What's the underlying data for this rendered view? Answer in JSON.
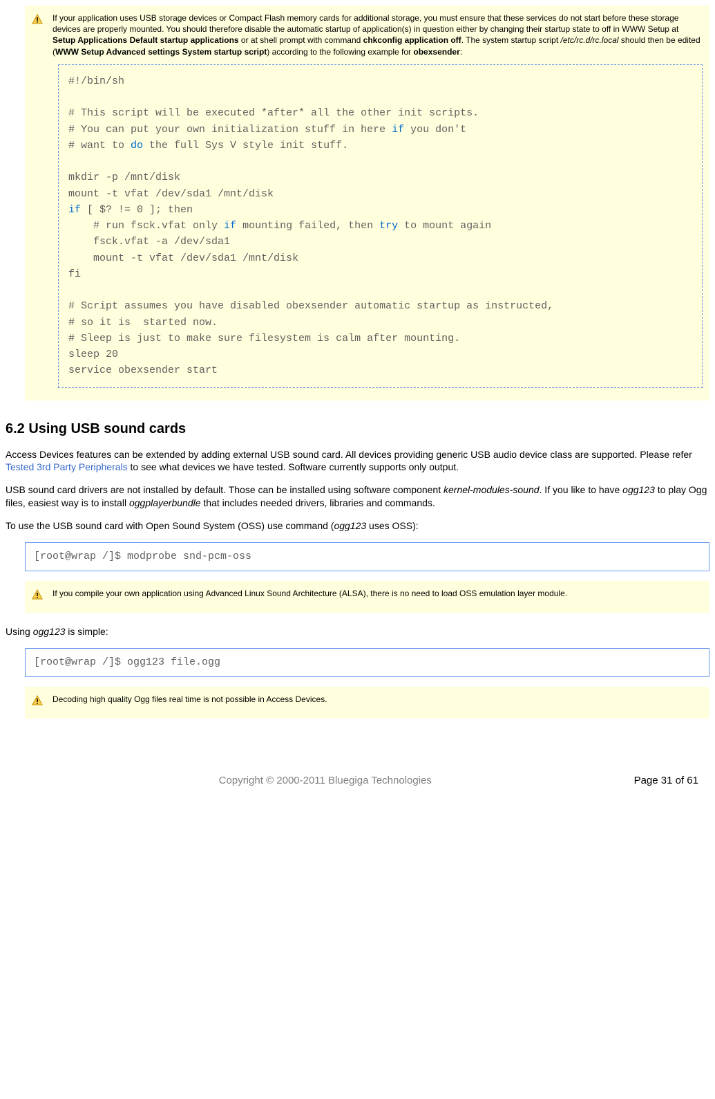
{
  "note1": {
    "pre1": "If your application uses USB storage devices or Compact Flash memory cards for additional storage, you must ensure that these services do not start before these storage devices are properly mounted. You should therefore disable the automatic startup of application(s) in question either by changing their startup state to off in WWW Setup at ",
    "bold1": "Setup  Applications Default startup applications",
    "mid1": " or at shell prompt with command ",
    "bold2": "chkconfig application off",
    "mid2": ". The system startup script ",
    "ital1": "/etc/rc.d/rc.local",
    "mid3": " should then be edited (",
    "bold3": "WWW Setup  Advanced settings  System startup script",
    "mid4": ") according to the following example for ",
    "bold4": "obexsender",
    "post": ":"
  },
  "code1": {
    "l1": "#!/bin/sh",
    "l2": "",
    "l3a": "# This script will be executed *after* all the other init scripts.",
    "l4a": "# You can put your own initialization stuff in here ",
    "l4b": "if",
    "l4c": " you don't",
    "l5a": "# want to ",
    "l5b": "do",
    "l5c": " the full Sys V style init stuff.",
    "l6": "",
    "l7": "mkdir -p /mnt/disk",
    "l8": "mount -t vfat /dev/sda1 /mnt/disk",
    "l9a": "if",
    "l9b": " [ $? != 0 ]; then",
    "l10a": "    # run fsck.vfat only ",
    "l10b": "if",
    "l10c": " mounting failed, then ",
    "l10d": "try",
    "l10e": " to mount again",
    "l11": "    fsck.vfat -a /dev/sda1",
    "l12": "    mount -t vfat /dev/sda1 /mnt/disk",
    "l13": "fi",
    "l14": "",
    "l15": "# Script assumes you have disabled obexsender automatic startup as instructed,",
    "l16": "# so it is  started now.",
    "l17": "# Sleep is just to make sure filesystem is calm after mounting.",
    "l18": "sleep 20",
    "l19": "service obexsender start"
  },
  "h2": "6.2 Using USB sound cards",
  "p1a": "Access Devices features can be extended by adding external USB sound card. All devices providing generic USB audio device class are supported. Please refer ",
  "p1link": "Tested 3rd Party Peripherals",
  "p1b": " to see what devices we have tested. Software currently supports only output.",
  "p2a": "USB sound card drivers are not installed by default. Those can be installed using software component ",
  "p2i1": "kernel-modules-sound",
  "p2b": ". If you like to have ",
  "p2i2": "ogg123",
  "p2c": " to play Ogg files, easiest way is to install ",
  "p2i3": "oggplayerbundle",
  "p2d": " that includes needed drivers, libraries and commands.",
  "p3a": "To use the USB sound card with Open Sound System (OSS) use command (",
  "p3i": "ogg123",
  "p3b": " uses OSS):",
  "cmd1": "[root@wrap /]$ modprobe snd-pcm-oss",
  "note2": "If you compile your own application using Advanced Linux Sound Architecture (ALSA), there is no need to load OSS emulation layer module.",
  "p4a": "Using ",
  "p4i": "ogg123",
  "p4b": " is simple:",
  "cmd2": "[root@wrap /]$ ogg123 file.ogg",
  "note3": "Decoding high quality Ogg files real time is not possible in Access Devices.",
  "footer_left": "Copyright © 2000-2011 Bluegiga Technologies",
  "footer_right": "Page 31 of 61"
}
